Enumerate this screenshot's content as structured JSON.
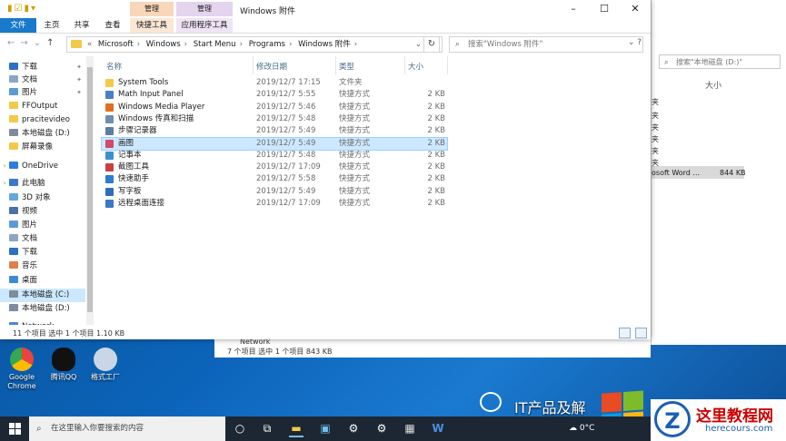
{
  "window": {
    "title": "Windows 附件",
    "context_tab_manage_1": "管理",
    "context_tab_manage_2": "管理",
    "minimize": "–",
    "maximize": "☐",
    "close": "✕"
  },
  "tabs": {
    "file": "文件",
    "home": "主页",
    "share": "共享",
    "view": "查看",
    "shortcut_tools": "快捷工具",
    "app_tools": "应用程序工具"
  },
  "address": {
    "overflow": "«",
    "crumbs": [
      "Microsoft",
      "Windows",
      "Start Menu",
      "Programs",
      "Windows 附件"
    ],
    "search_placeholder": "搜索\"Windows 附件\""
  },
  "nav": [
    {
      "label": "下载",
      "icon": "download-arrow-icon",
      "pinned": true
    },
    {
      "label": "文档",
      "icon": "document-icon",
      "pinned": true
    },
    {
      "label": "图片",
      "icon": "picture-icon",
      "pinned": true
    },
    {
      "label": "FFOutput",
      "icon": "folder-icon",
      "pinned": false
    },
    {
      "label": "pracitevideo",
      "icon": "folder-icon",
      "pinned": false
    },
    {
      "label": "本地磁盘 (D:)",
      "icon": "drive-icon",
      "pinned": false
    },
    {
      "label": "屏幕录像",
      "icon": "folder-icon",
      "pinned": false
    },
    {
      "label": "OneDrive",
      "icon": "cloud-icon",
      "pinned": false
    },
    {
      "label": "此电脑",
      "icon": "computer-icon",
      "pinned": false
    },
    {
      "label": "3D 对象",
      "icon": "cube-icon",
      "pinned": false
    },
    {
      "label": "视频",
      "icon": "video-icon",
      "pinned": false
    },
    {
      "label": "图片",
      "icon": "picture-icon",
      "pinned": false
    },
    {
      "label": "文档",
      "icon": "document-icon",
      "pinned": false
    },
    {
      "label": "下载",
      "icon": "download-arrow-icon",
      "pinned": false
    },
    {
      "label": "音乐",
      "icon": "music-icon",
      "pinned": false
    },
    {
      "label": "桌面",
      "icon": "desktop-icon",
      "pinned": false
    },
    {
      "label": "本地磁盘 (C:)",
      "icon": "drive-icon",
      "pinned": false,
      "selected": true
    },
    {
      "label": "本地磁盘 (D:)",
      "icon": "drive-icon",
      "pinned": false
    },
    {
      "label": "Network",
      "icon": "network-icon",
      "pinned": false
    }
  ],
  "columns": {
    "name": "名称",
    "date": "修改日期",
    "type": "类型",
    "size": "大小"
  },
  "files": [
    {
      "name": "System Tools",
      "date": "2019/12/7 17:15",
      "type": "文件夹",
      "size": "",
      "icon": "folder-icon",
      "color": "#f3c94a"
    },
    {
      "name": "Math Input Panel",
      "date": "2019/12/7 5:55",
      "type": "快捷方式",
      "size": "2 KB",
      "icon": "math-panel-icon",
      "color": "#4a7fc1"
    },
    {
      "name": "Windows Media Player",
      "date": "2019/12/7 5:46",
      "type": "快捷方式",
      "size": "2 KB",
      "icon": "media-player-icon",
      "color": "#e0701f"
    },
    {
      "name": "Windows 传真和扫描",
      "date": "2019/12/7 5:48",
      "type": "快捷方式",
      "size": "2 KB",
      "icon": "fax-scan-icon",
      "color": "#6a8fb0"
    },
    {
      "name": "步骤记录器",
      "date": "2019/12/7 5:49",
      "type": "快捷方式",
      "size": "2 KB",
      "icon": "steps-recorder-icon",
      "color": "#5b7fa3"
    },
    {
      "name": "画图",
      "date": "2019/12/7 5:49",
      "type": "快捷方式",
      "size": "2 KB",
      "icon": "paint-icon",
      "color": "#d04a6a",
      "selected": true
    },
    {
      "name": "记事本",
      "date": "2019/12/7 5:48",
      "type": "快捷方式",
      "size": "2 KB",
      "icon": "notepad-icon",
      "color": "#3d8fd1"
    },
    {
      "name": "截图工具",
      "date": "2019/12/7 17:09",
      "type": "快捷方式",
      "size": "2 KB",
      "icon": "snipping-tool-icon",
      "color": "#c94040"
    },
    {
      "name": "快速助手",
      "date": "2019/12/7 5:58",
      "type": "快捷方式",
      "size": "2 KB",
      "icon": "quick-assist-icon",
      "color": "#2b7bd0"
    },
    {
      "name": "写字板",
      "date": "2019/12/7 5:49",
      "type": "快捷方式",
      "size": "2 KB",
      "icon": "wordpad-icon",
      "color": "#2f6fb8"
    },
    {
      "name": "远程桌面连接",
      "date": "2019/12/7 17:09",
      "type": "快捷方式",
      "size": "2 KB",
      "icon": "remote-desktop-icon",
      "color": "#3b78c4"
    }
  ],
  "status": {
    "text": "11 个项目    选中 1 个项目  1.10 KB"
  },
  "bg_window": {
    "search_placeholder": "搜索\"本地磁盘 (D:)\"",
    "size_col": "大小",
    "row_marks": [
      "夹",
      "夹",
      "夹",
      "夹",
      "夹",
      "夹"
    ],
    "sel_name": "osoft Word ...",
    "sel_size": "844 KB",
    "status_text": "7 个项目    选中 1 个项目  843 KB",
    "network": "Network"
  },
  "desktop_icons": [
    {
      "label": "Google Chrome",
      "color": "#e8453c"
    },
    {
      "label": "腾讯QQ",
      "color": "#111111"
    },
    {
      "label": "格式工厂",
      "color": "#c9d6e6"
    }
  ],
  "watermark": {
    "left_text": "IT产品及解",
    "brand": "这里教程网",
    "domain": "herecours.com"
  },
  "taskbar": {
    "search_placeholder": "在这里输入你要搜索的内容",
    "weather": "0°C"
  }
}
